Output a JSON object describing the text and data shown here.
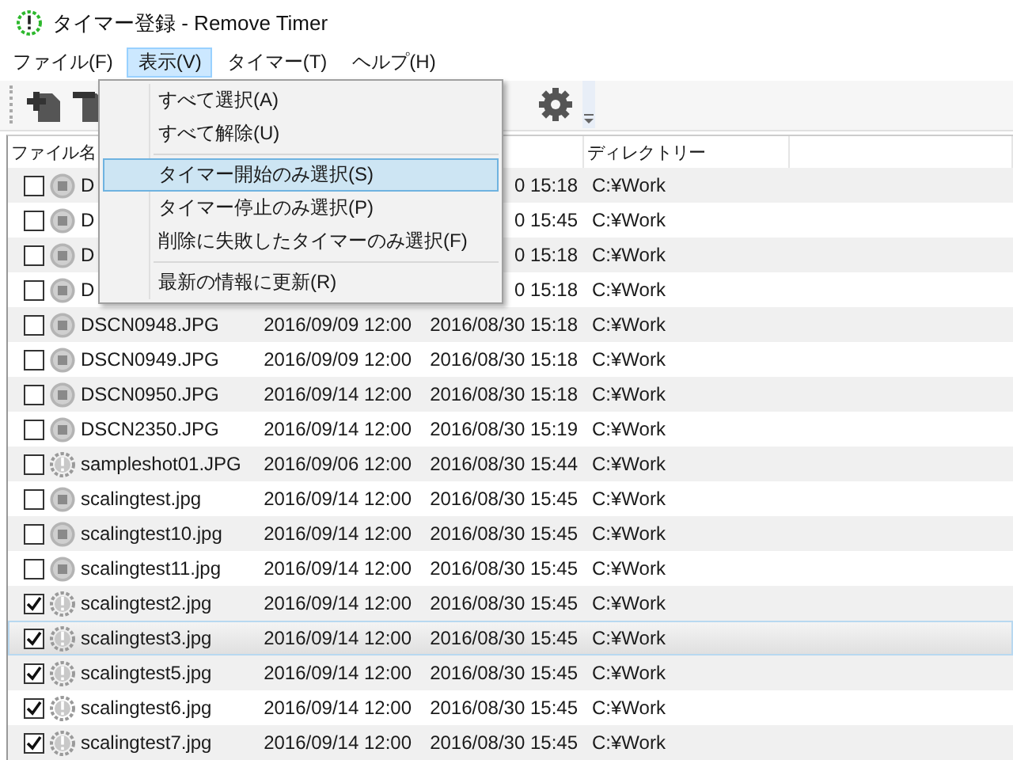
{
  "window": {
    "title": "タイマー登録 - Remove Timer"
  },
  "menu_bar": [
    {
      "label": "ファイル(F)",
      "selected": false
    },
    {
      "label": "表示(V)",
      "selected": true
    },
    {
      "label": "タイマー(T)",
      "selected": false
    },
    {
      "label": "ヘルプ(H)",
      "selected": false
    }
  ],
  "view_menu": {
    "items": [
      {
        "label": "すべて選択(A)",
        "selected": false,
        "separator_after": false
      },
      {
        "label": "すべて解除(U)",
        "selected": false,
        "separator_after": true
      },
      {
        "label": "タイマー開始のみ選択(S)",
        "selected": true,
        "separator_after": false
      },
      {
        "label": "タイマー停止のみ選択(P)",
        "selected": false,
        "separator_after": false
      },
      {
        "label": "削除に失敗したタイマーのみ選択(F)",
        "selected": false,
        "separator_after": true
      },
      {
        "label": "最新の情報に更新(R)",
        "selected": false,
        "separator_after": false
      }
    ]
  },
  "table": {
    "columns": [
      {
        "label": "ファイル名"
      },
      {},
      {},
      {
        "label": "ディレクトリー"
      }
    ],
    "rows": [
      {
        "checked": false,
        "kind": "stopped",
        "selected": false,
        "name": "D",
        "column_3": "0 15:18",
        "directory": "C:¥Work"
      },
      {
        "checked": false,
        "kind": "stopped",
        "selected": false,
        "name": "D",
        "column_3": "0 15:45",
        "directory": "C:¥Work"
      },
      {
        "checked": false,
        "kind": "stopped",
        "selected": false,
        "name": "D",
        "column_3": "0 15:18",
        "directory": "C:¥Work"
      },
      {
        "checked": false,
        "kind": "stopped",
        "selected": false,
        "name": "D",
        "column_3": "0 15:18",
        "directory": "C:¥Work"
      },
      {
        "checked": false,
        "kind": "stopped",
        "selected": false,
        "name": "DSCN0948.JPG",
        "column_2": "2016/09/09 12:00",
        "column_3": "2016/08/30 15:18",
        "directory": "C:¥Work"
      },
      {
        "checked": false,
        "kind": "stopped",
        "selected": false,
        "name": "DSCN0949.JPG",
        "column_2": "2016/09/09 12:00",
        "column_3": "2016/08/30 15:18",
        "directory": "C:¥Work"
      },
      {
        "checked": false,
        "kind": "stopped",
        "selected": false,
        "name": "DSCN0950.JPG",
        "column_2": "2016/09/14 12:00",
        "column_3": "2016/08/30 15:18",
        "directory": "C:¥Work"
      },
      {
        "checked": false,
        "kind": "stopped",
        "selected": false,
        "name": "DSCN2350.JPG",
        "column_2": "2016/09/14 12:00",
        "column_3": "2016/08/30 15:19",
        "directory": "C:¥Work"
      },
      {
        "checked": false,
        "kind": "timer",
        "selected": false,
        "name": "sampleshot01.JPG",
        "column_2": "2016/09/06 12:00",
        "column_3": "2016/08/30 15:44",
        "directory": "C:¥Work"
      },
      {
        "checked": false,
        "kind": "stopped",
        "selected": false,
        "name": "scalingtest.jpg",
        "column_2": "2016/09/14 12:00",
        "column_3": "2016/08/30 15:45",
        "directory": "C:¥Work"
      },
      {
        "checked": false,
        "kind": "stopped",
        "selected": false,
        "name": "scalingtest10.jpg",
        "column_2": "2016/09/14 12:00",
        "column_3": "2016/08/30 15:45",
        "directory": "C:¥Work"
      },
      {
        "checked": false,
        "kind": "stopped",
        "selected": false,
        "name": "scalingtest11.jpg",
        "column_2": "2016/09/14 12:00",
        "column_3": "2016/08/30 15:45",
        "directory": "C:¥Work"
      },
      {
        "checked": true,
        "kind": "timer",
        "selected": false,
        "name": "scalingtest2.jpg",
        "column_2": "2016/09/14 12:00",
        "column_3": "2016/08/30 15:45",
        "directory": "C:¥Work"
      },
      {
        "checked": true,
        "kind": "timer",
        "selected": true,
        "name": "scalingtest3.jpg",
        "column_2": "2016/09/14 12:00",
        "column_3": "2016/08/30 15:45",
        "directory": "C:¥Work"
      },
      {
        "checked": true,
        "kind": "timer",
        "selected": false,
        "name": "scalingtest5.jpg",
        "column_2": "2016/09/14 12:00",
        "column_3": "2016/08/30 15:45",
        "directory": "C:¥Work"
      },
      {
        "checked": true,
        "kind": "timer",
        "selected": false,
        "name": "scalingtest6.jpg",
        "column_2": "2016/09/14 12:00",
        "column_3": "2016/08/30 15:45",
        "directory": "C:¥Work"
      },
      {
        "checked": true,
        "kind": "timer",
        "selected": false,
        "name": "scalingtest7.jpg",
        "column_2": "2016/09/14 12:00",
        "column_3": "2016/08/30 15:45",
        "directory": "C:¥Work"
      }
    ]
  }
}
